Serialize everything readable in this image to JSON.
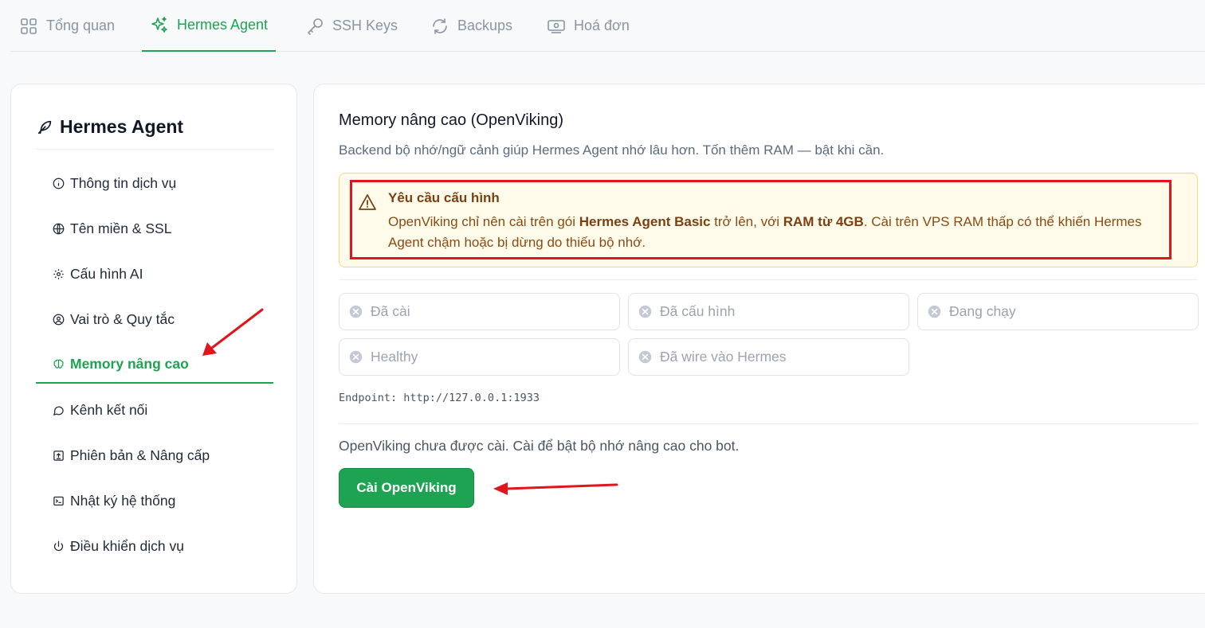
{
  "tabs": [
    {
      "label": "Tổng quan",
      "icon": "grid-icon"
    },
    {
      "label": "Hermes Agent",
      "icon": "sparkles-icon"
    },
    {
      "label": "SSH Keys",
      "icon": "key-icon"
    },
    {
      "label": "Backups",
      "icon": "refresh-icon"
    },
    {
      "label": "Hoá đơn",
      "icon": "bill-icon"
    }
  ],
  "active_tab": "Hermes Agent",
  "sidebar": {
    "title": "Hermes Agent",
    "items": [
      {
        "label": "Thông tin dịch vụ",
        "icon": "info-icon"
      },
      {
        "label": "Tên miền & SSL",
        "icon": "globe-icon"
      },
      {
        "label": "Cấu hình AI",
        "icon": "gear-icon"
      },
      {
        "label": "Vai trò & Quy tắc",
        "icon": "user-role-icon"
      },
      {
        "label": "Memory nâng cao",
        "icon": "brain-icon"
      },
      {
        "label": "Kênh kết nối",
        "icon": "chat-icon"
      },
      {
        "label": "Phiên bản & Nâng cấp",
        "icon": "upgrade-icon"
      },
      {
        "label": "Nhật ký hệ thống",
        "icon": "terminal-icon"
      },
      {
        "label": "Điều khiển dịch vụ",
        "icon": "power-icon"
      }
    ],
    "active_item": "Memory nâng cao"
  },
  "main": {
    "title": "Memory nâng cao (OpenViking)",
    "description": "Backend bộ nhớ/ngữ cảnh giúp Hermes Agent nhớ lâu hơn. Tốn thêm RAM — bật khi cần.",
    "alert": {
      "title": "Yêu cầu cấu hình",
      "body_1": "OpenViking chỉ nên cài trên gói ",
      "body_bold_1": "Hermes Agent Basic",
      "body_2": " trở lên, với ",
      "body_bold_2": "RAM từ 4GB",
      "body_3": ". Cài trên VPS RAM thấp có thể khiến Hermes Agent chậm hoặc bị dừng do thiếu bộ nhớ."
    },
    "status_chips": [
      {
        "label": "Đã cài"
      },
      {
        "label": "Đã cấu hình"
      },
      {
        "label": "Đang chạy"
      },
      {
        "label": "Healthy"
      },
      {
        "label": "Đã wire vào Hermes"
      }
    ],
    "endpoint": "Endpoint: http://127.0.0.1:1933",
    "status_text": "OpenViking chưa được cài. Cài để bật bộ nhớ nâng cao cho bot.",
    "install_button": "Cài OpenViking"
  },
  "colors": {
    "accent": "#1ea352",
    "annotation": "#e0161c",
    "alert_bg": "#fffbeb"
  }
}
